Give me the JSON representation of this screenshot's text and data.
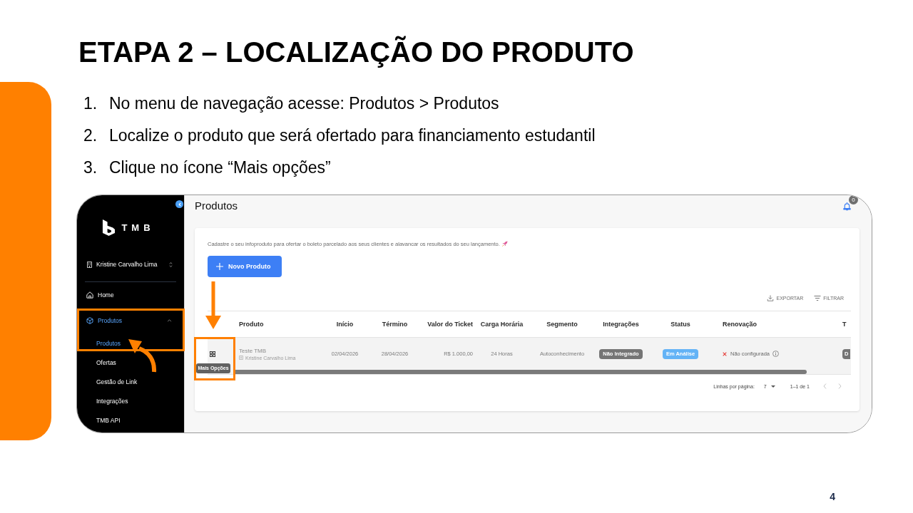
{
  "slide": {
    "title": "ETAPA 2 – LOCALIZAÇÃO DO PRODUTO",
    "steps": [
      {
        "number": "1.",
        "text": "No menu de navegação acesse: Produtos > Produtos"
      },
      {
        "number": "2.",
        "text": "Localize o produto que será ofertado para financiamento estudantil"
      },
      {
        "number": "3.",
        "text": "Clique no ícone “Mais opções”"
      }
    ],
    "page_number": "4"
  },
  "screenshot": {
    "sidebar": {
      "logo_text": "TMB",
      "account": "Kristine Carvalho Lima",
      "items": [
        {
          "label": "Home",
          "selected": false
        },
        {
          "label": "Produtos",
          "selected": true,
          "expanded": true,
          "children": [
            {
              "label": "Produtos",
              "selected": true
            },
            {
              "label": "Ofertas",
              "selected": false
            },
            {
              "label": "Gestão de Link",
              "selected": false
            },
            {
              "label": "Integrações",
              "selected": false
            },
            {
              "label": "TMB API",
              "selected": false
            }
          ]
        }
      ]
    },
    "header": {
      "title": "Produtos",
      "notification_count": "0"
    },
    "card": {
      "description": "Cadastre o seu infoproduto para ofertar o boleto parcelado aos seus clientes e alavancar os resultados do seu lançamento.",
      "new_button": "Novo Produto",
      "toolbar": [
        "EXPORTAR",
        "FILTRAR"
      ],
      "table": {
        "columns": [
          "Produto",
          "Início",
          "Término",
          "Valor do Ticket",
          "Carga Horária",
          "Segmento",
          "Integrações",
          "Status",
          "Renovação",
          "T"
        ],
        "rows": [
          {
            "product": "Teste TMB",
            "owner": "Kristine Carvalho Lima",
            "start": "02/04/2026",
            "end": "28/04/2026",
            "ticket": "R$ 1.000,00",
            "hours": "24 Horas",
            "segment": "Autoconhecimento",
            "integration": "Não Integrado",
            "status": "Em Análise",
            "renewal": "Não configurada",
            "column_10": "D",
            "tooltip": "Mais Opções"
          }
        ]
      },
      "pagination": {
        "rows_label": "Linhas por página:",
        "rows_per_page": "7",
        "range": "1–1 de 1",
        "previous_disabled": true,
        "next_disabled": true
      }
    }
  }
}
